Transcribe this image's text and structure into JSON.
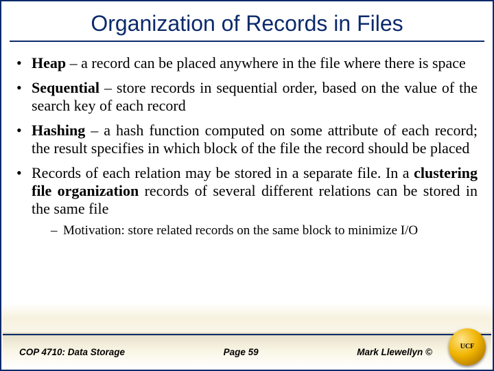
{
  "title": "Organization of Records in Files",
  "bullets": [
    {
      "term": "Heap",
      "desc": " – a record can be placed anywhere in the file where there is space"
    },
    {
      "term": "Sequential",
      "desc": " – store records in sequential order, based on the value of the search key of each record"
    },
    {
      "term": "Hashing",
      "desc": " – a hash function computed on some attribute of each record; the result specifies in which block of the file the record should be placed"
    },
    {
      "pre": "Records of each relation may be stored in a separate file. In a ",
      "term": "clustering file organization",
      "post": " records of several different relations can be stored in the same file"
    }
  ],
  "subbullet": "Motivation: store related records on the same block to minimize I/O",
  "footer": {
    "course": "COP 4710: Data Storage",
    "page": "Page 59",
    "author": "Mark Llewellyn ©"
  },
  "logo_text": "UCF"
}
